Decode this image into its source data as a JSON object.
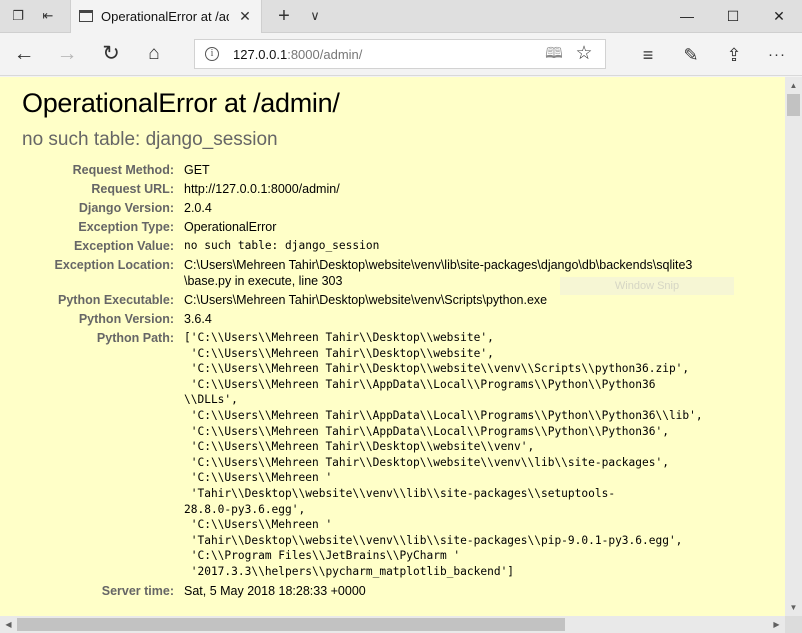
{
  "browser": {
    "tab_title": "OperationalError at /admin/",
    "address_host": "127.0.0.1",
    "address_rest": ":8000/admin/",
    "icons": {
      "tab_manager": "tab-manager-icon",
      "set_aside": "set-aside-tabs-icon",
      "back": "arrow-left-icon",
      "forward": "arrow-right-icon",
      "refresh": "refresh-icon",
      "home": "home-icon",
      "info": "info-icon",
      "reading_view": "book-icon",
      "favorite": "star-icon",
      "hub": "favorites-hub-icon",
      "notes": "pen-icon",
      "share": "share-icon",
      "more": "more-dots-icon"
    }
  },
  "page": {
    "title": "OperationalError at /admin/",
    "subtitle": "no such table: django_session",
    "meta": [
      {
        "key": "Request Method:",
        "value": "GET",
        "mono": false
      },
      {
        "key": "Request URL:",
        "value": "http://127.0.0.1:8000/admin/",
        "mono": false
      },
      {
        "key": "Django Version:",
        "value": "2.0.4",
        "mono": false
      },
      {
        "key": "Exception Type:",
        "value": "OperationalError",
        "mono": false
      },
      {
        "key": "Exception Value:",
        "value": "no such table: django_session",
        "mono": true
      },
      {
        "key": "Exception Location:",
        "value": "C:\\Users\\Mehreen Tahir\\Desktop\\website\\venv\\lib\\site-packages\\django\\db\\backends\\sqlite3\n\\base.py in execute, line 303",
        "mono": false
      },
      {
        "key": "Python Executable:",
        "value": "C:\\Users\\Mehreen Tahir\\Desktop\\website\\venv\\Scripts\\python.exe",
        "mono": false
      },
      {
        "key": "Python Version:",
        "value": "3.6.4",
        "mono": false
      },
      {
        "key": "Python Path:",
        "value": "['C:\\\\Users\\\\Mehreen Tahir\\\\Desktop\\\\website',\n 'C:\\\\Users\\\\Mehreen Tahir\\\\Desktop\\\\website',\n 'C:\\\\Users\\\\Mehreen Tahir\\\\Desktop\\\\website\\\\venv\\\\Scripts\\\\python36.zip',\n 'C:\\\\Users\\\\Mehreen Tahir\\\\AppData\\\\Local\\\\Programs\\\\Python\\\\Python36\n\\\\DLLs',\n 'C:\\\\Users\\\\Mehreen Tahir\\\\AppData\\\\Local\\\\Programs\\\\Python\\\\Python36\\\\lib',\n 'C:\\\\Users\\\\Mehreen Tahir\\\\AppData\\\\Local\\\\Programs\\\\Python\\\\Python36',\n 'C:\\\\Users\\\\Mehreen Tahir\\\\Desktop\\\\website\\\\venv',\n 'C:\\\\Users\\\\Mehreen Tahir\\\\Desktop\\\\website\\\\venv\\\\lib\\\\site-packages',\n 'C:\\\\Users\\\\Mehreen '\n 'Tahir\\\\Desktop\\\\website\\\\venv\\\\lib\\\\site-packages\\\\setuptools-\n28.8.0-py3.6.egg',\n 'C:\\\\Users\\\\Mehreen '\n 'Tahir\\\\Desktop\\\\website\\\\venv\\\\lib\\\\site-packages\\\\pip-9.0.1-py3.6.egg',\n 'C:\\\\Program Files\\\\JetBrains\\\\PyCharm '\n '2017.3.3\\\\helpers\\\\pycharm_matplotlib_backend']",
        "mono": true
      },
      {
        "key": "Server time:",
        "value": "Sat, 5 May 2018 18:28:33 +0000",
        "mono": false
      }
    ],
    "overlay_text": "Window Snip"
  },
  "colors": {
    "page_background": "#ffffc8",
    "label": "#666666",
    "subtitle": "#666666"
  }
}
